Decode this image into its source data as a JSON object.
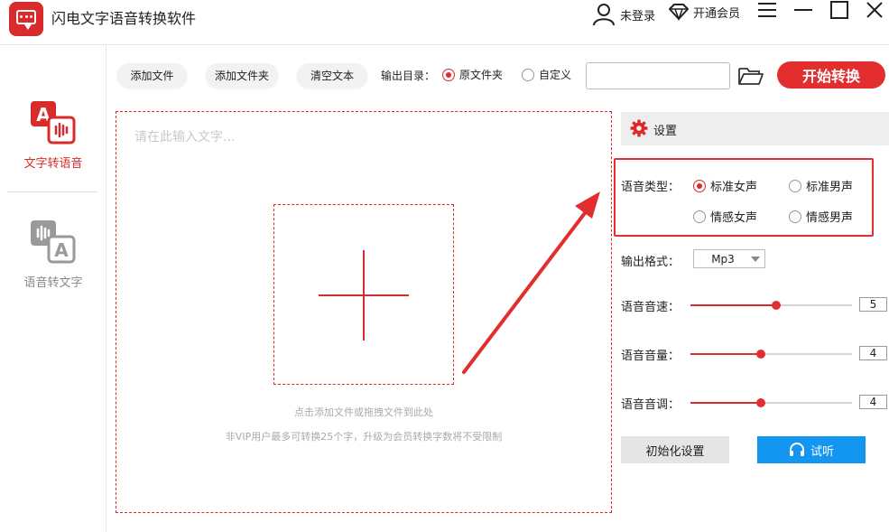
{
  "app": {
    "title": "闪电文字语音转换软件",
    "login": "未登录",
    "vip": "开通会员"
  },
  "sidebar": {
    "items": [
      {
        "label": "文字转语音",
        "icon": "text-to-speech-icon",
        "active": true
      },
      {
        "label": "语音转文字",
        "icon": "speech-to-text-icon",
        "active": false
      }
    ]
  },
  "toolbar": {
    "add_file": "添加文件",
    "add_folder": "添加文件夹",
    "clear_text": "清空文本",
    "output_dir_label": "输出目录：",
    "option_original": "原文件夹",
    "option_custom": "自定义",
    "selected_option": "原文件夹",
    "path_value": "",
    "start": "开始转换"
  },
  "editor": {
    "placeholder": "请在此输入文字...",
    "drop_hint": "点击添加文件或拖拽文件到此处",
    "limit_hint": "非VIP用户最多可转换25个字，升级为会员转换字数将不受限制"
  },
  "settings": {
    "title": "设置",
    "voice_type_label": "语音类型：",
    "voices": [
      "标准女声",
      "标准男声",
      "情感女声",
      "情感男声"
    ],
    "selected_voice": "标准女声",
    "format_label": "输出格式：",
    "format_value": "Mp3",
    "speed_label": "语音音速：",
    "speed_value": "5",
    "volume_label": "语音音量：",
    "volume_value": "4",
    "pitch_label": "语音音调：",
    "pitch_value": "4",
    "slider_max": 10,
    "reset": "初始化设置",
    "listen": "试听"
  },
  "colors": {
    "accent": "#e22e2e",
    "listen": "#1296f0"
  }
}
